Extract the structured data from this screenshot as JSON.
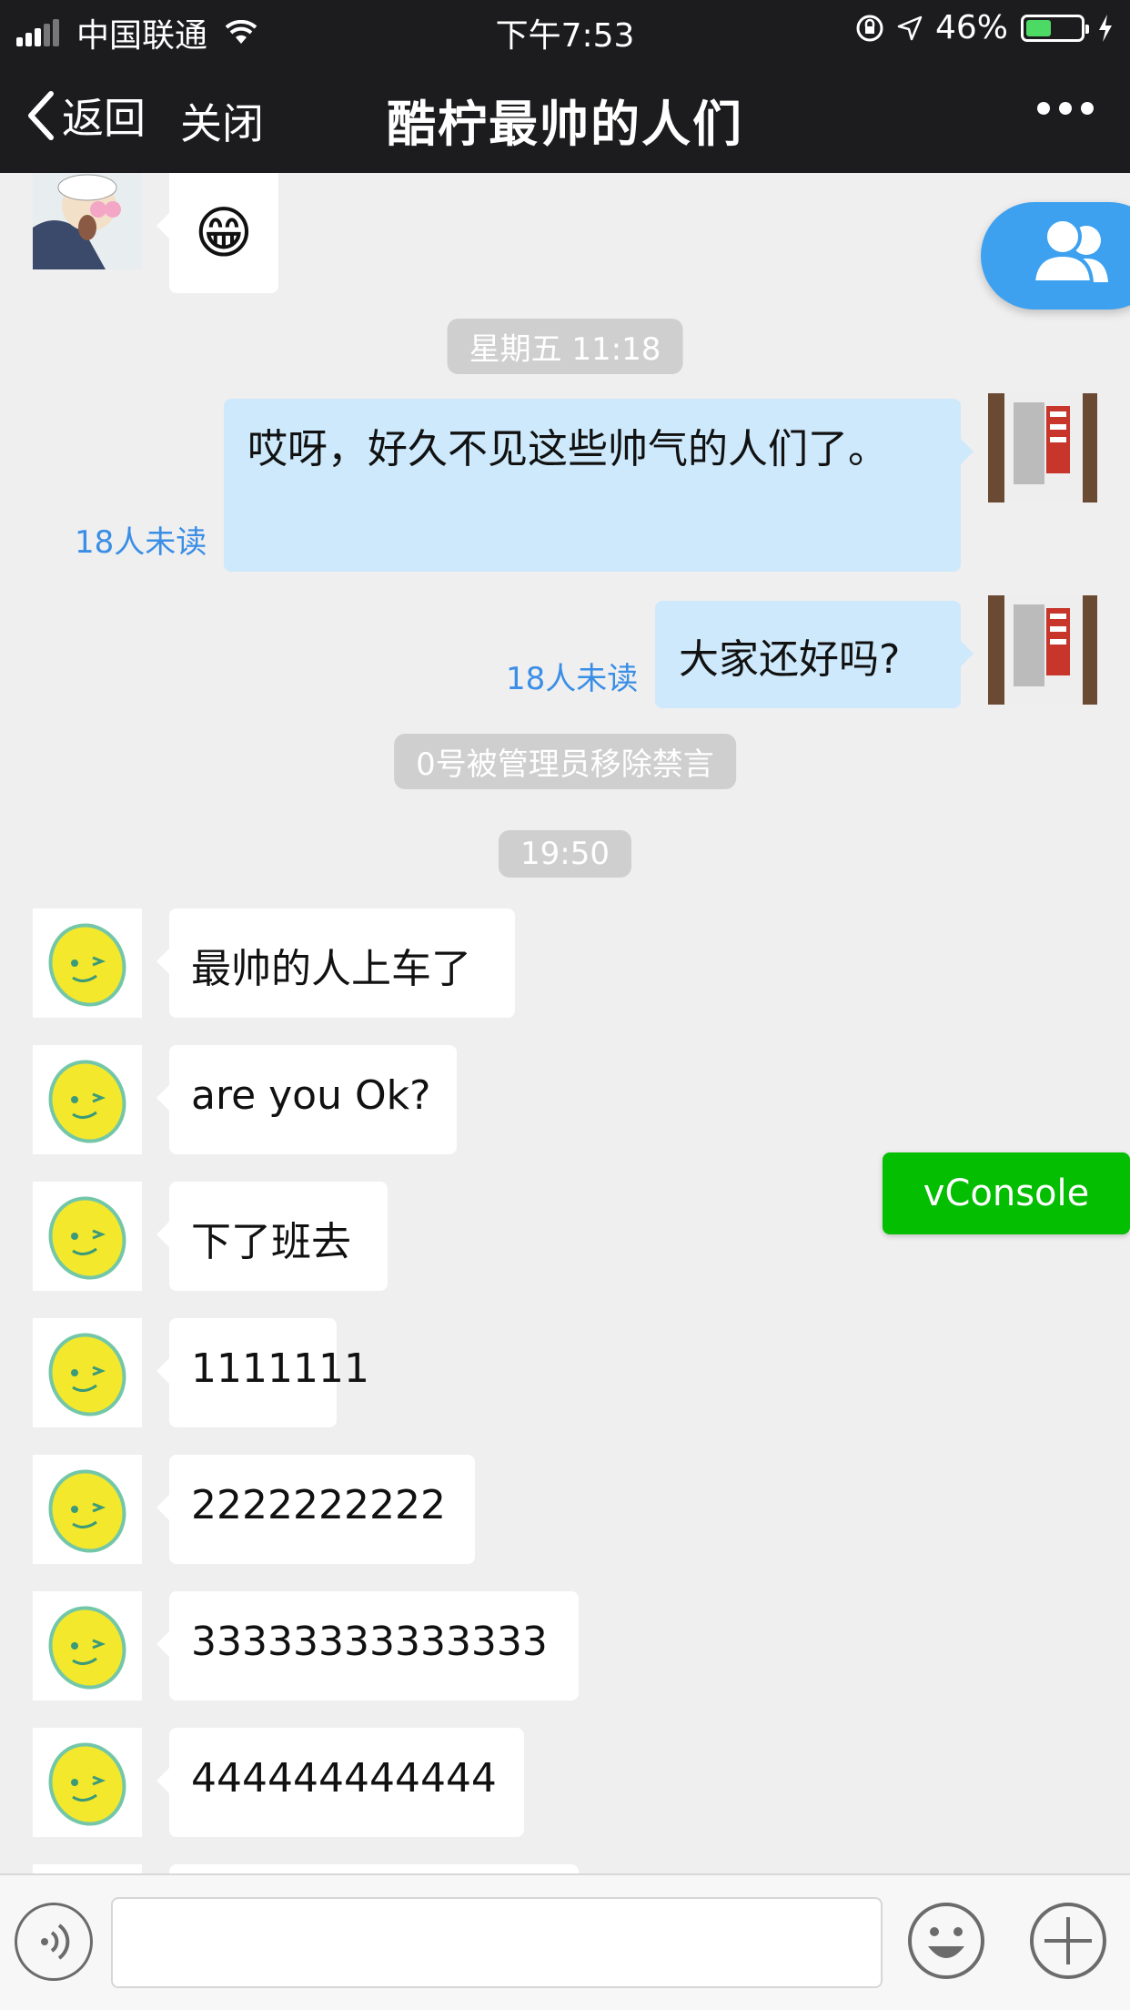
{
  "status_bar": {
    "carrier": "中国联通",
    "time": "下午7:53",
    "battery_percent": "46%",
    "battery_level": 0.46,
    "battery_color": "#4cd964"
  },
  "nav": {
    "back_label": "返回",
    "close_label": "关闭",
    "title": "酷柠最帅的人们",
    "more_icon": "more-dots-icon"
  },
  "chat": {
    "top_message": {
      "sender_avatar": "cartoon-avatar",
      "content": "😁"
    },
    "timestamp_1": "星期五 11:18",
    "my_messages": [
      {
        "text": "哎呀，好久不见这些帅气的人们了。",
        "unread": "18人未读"
      },
      {
        "text": "大家还好吗?",
        "unread": "18人未读"
      }
    ],
    "system_notice": "0号被管理员移除禁言",
    "timestamp_2": "19:50",
    "messages": [
      {
        "text": "最帅的人上车了"
      },
      {
        "text": "are you Ok?"
      },
      {
        "text": "下了班去"
      },
      {
        "text": "1111111"
      },
      {
        "text": "2222222222"
      },
      {
        "text": "33333333333333"
      },
      {
        "text": "444444444444"
      }
    ]
  },
  "floating": {
    "members_icon": "group-members-icon",
    "vconsole_label": "vConsole",
    "accent": "#3da1f0",
    "vconsole_color": "#04be02"
  },
  "input_bar": {
    "voice_icon": "voice-icon",
    "emoji_icon": "emoji-icon",
    "plus_icon": "plus-icon"
  }
}
